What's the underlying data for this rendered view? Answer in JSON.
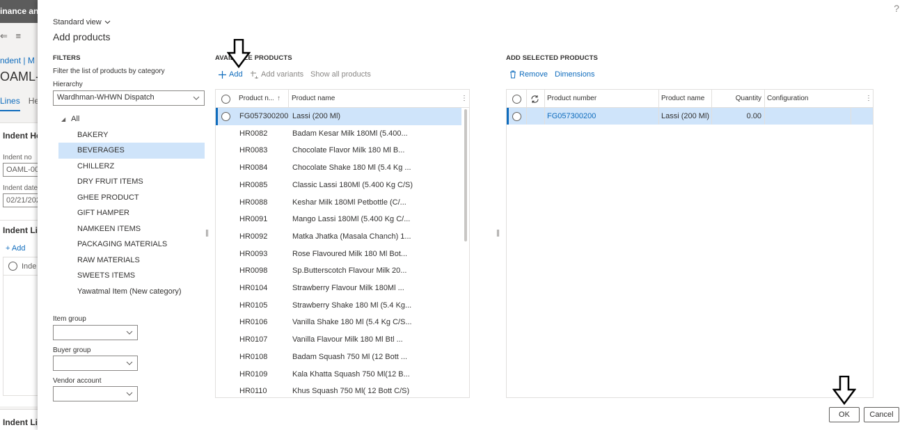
{
  "background": {
    "app_title": "inance and",
    "breadcrumb": "ndent  |  M",
    "page_title": "OAML-",
    "tab_lines": "Lines",
    "tab_header": "He",
    "section_header": "Indent He",
    "indent_no_label": "Indent no",
    "indent_no_value": "OAML-00",
    "indent_date_label": "Indent date",
    "indent_date_value": "02/21/202",
    "section_lines": "Indent Lin",
    "add_label": "Add",
    "grid_col": "Inde",
    "section_bottom": "Indent Lin"
  },
  "dialog": {
    "help": "?",
    "standard_view": "Standard view",
    "title": "Add products"
  },
  "filters": {
    "heading": "FILTERS",
    "description": "Filter the list of products by category",
    "hierarchy_label": "Hierarchy",
    "hierarchy_value": "Wardhman-WHWN Dispatch",
    "tree_root": "All",
    "categories": [
      "BAKERY",
      "BEVERAGES",
      "CHILLERZ",
      "DRY FRUIT ITEMS",
      "GHEE PRODUCT",
      "GIFT HAMPER",
      "NAMKEEN ITEMS",
      "PACKAGING MATERIALS",
      "RAW MATERIALS",
      "SWEETS ITEMS",
      "Yawatmal Item (New category)"
    ],
    "selected_category": "BEVERAGES",
    "item_group_label": "Item group",
    "item_group_value": "",
    "buyer_group_label": "Buyer group",
    "buyer_group_value": "",
    "vendor_account_label": "Vendor account",
    "vendor_account_value": ""
  },
  "available": {
    "heading": "AVAILABLE PRODUCTS",
    "add": "Add",
    "add_variants": "Add variants",
    "show_all": "Show all products",
    "col_number": "Product n...",
    "col_name": "Product name",
    "rows": [
      {
        "number": "FG057300200",
        "name": "Lassi (200 Ml)"
      },
      {
        "number": "HR0082",
        "name": "Badam Kesar Milk 180Ml (5.400..."
      },
      {
        "number": "HR0083",
        "name": "Chocolate Flavor Milk 180 Ml B..."
      },
      {
        "number": "HR0084",
        "name": "Chocolate Shake 180 Ml (5.4 Kg ..."
      },
      {
        "number": "HR0085",
        "name": "Classic Lassi 180Ml (5.400 Kg C/S)"
      },
      {
        "number": "HR0088",
        "name": "Keshar Milk 180Ml Petbottle (C/..."
      },
      {
        "number": "HR0091",
        "name": "Mango Lassi 180Ml (5.400 Kg C/..."
      },
      {
        "number": "HR0092",
        "name": "Matka Jhatka (Masala Chanch) 1..."
      },
      {
        "number": "HR0093",
        "name": "Rose Flavoured Milk 180 Ml Bot..."
      },
      {
        "number": "HR0098",
        "name": "Sp.Butterscotch Flavour Milk 20..."
      },
      {
        "number": "HR0104",
        "name": "Strawberry Flavour Milk 180Ml ..."
      },
      {
        "number": "HR0105",
        "name": "Strawberry Shake 180 Ml (5.4 Kg..."
      },
      {
        "number": "HR0106",
        "name": "Vanilla Shake 180 Ml (5.4 Kg C/S..."
      },
      {
        "number": "HR0107",
        "name": "Vanilla Flavour Milk 180 Ml Btl ..."
      },
      {
        "number": "HR0108",
        "name": "Badam Squash 750 Ml (12 Bott ..."
      },
      {
        "number": "HR0109",
        "name": "Kala Khatta Squash 750 Ml(12 B..."
      },
      {
        "number": "HR0110",
        "name": "Khus Squash 750 Ml( 12 Bott C/S)"
      }
    ]
  },
  "selected": {
    "heading": "ADD SELECTED PRODUCTS",
    "remove": "Remove",
    "dimensions": "Dimensions",
    "col_number": "Product number",
    "col_name": "Product name",
    "col_quantity": "Quantity",
    "col_configuration": "Configuration",
    "rows": [
      {
        "number": "FG057300200",
        "name": "Lassi (200 Ml)",
        "quantity": "0.00",
        "configuration": ""
      }
    ]
  },
  "buttons": {
    "ok": "OK",
    "cancel": "Cancel"
  },
  "colors": {
    "accent": "#0f6cbd",
    "selection": "#cfe4fa"
  }
}
